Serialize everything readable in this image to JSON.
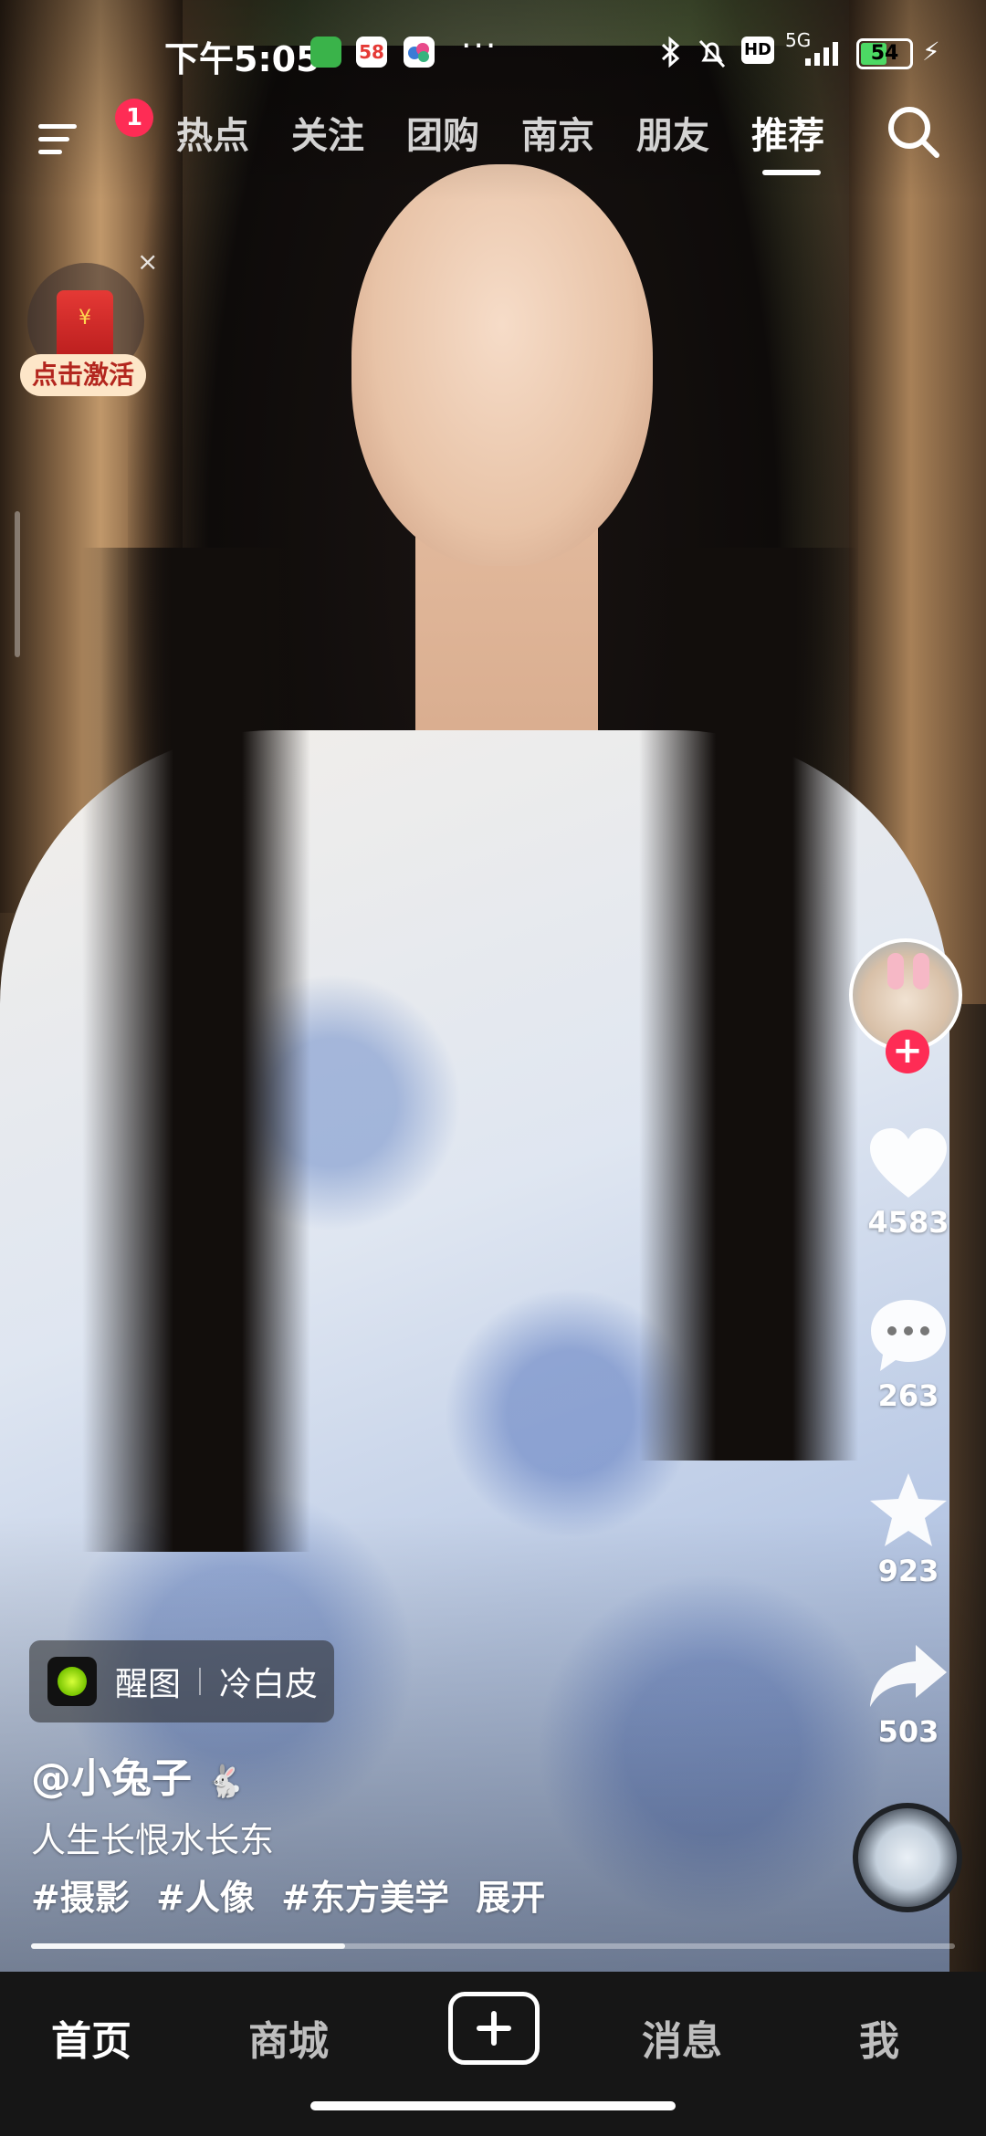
{
  "status_bar": {
    "time": "下午5:05",
    "app_icon_badge": "58",
    "network": "5G",
    "battery": "54",
    "battery_level": 0.54
  },
  "top_nav": {
    "menu_badge": "1",
    "tabs": [
      {
        "label": "热点"
      },
      {
        "label": "关注"
      },
      {
        "label": "团购"
      },
      {
        "label": "南京"
      },
      {
        "label": "朋友"
      },
      {
        "label": "推荐",
        "active": true
      }
    ]
  },
  "red_packet": {
    "label": "点击激活",
    "close": "×"
  },
  "right_rail": {
    "like_count": "4583",
    "comment_count": "263",
    "favorite_count": "923",
    "share_count": "503"
  },
  "video_info": {
    "effect_name": "醒图",
    "effect_style": "冷白皮",
    "username": "@小兔子",
    "caption": "人生长恨水长东",
    "hashtags": [
      "#摄影",
      "#人像",
      "#东方美学"
    ],
    "expand": "展开",
    "progress": 0.34
  },
  "tab_bar": {
    "items": [
      "首页",
      "商城",
      "消息",
      "我"
    ]
  },
  "colors": {
    "accent": "#fe2c55",
    "tab_bar_bg": "#161616"
  }
}
